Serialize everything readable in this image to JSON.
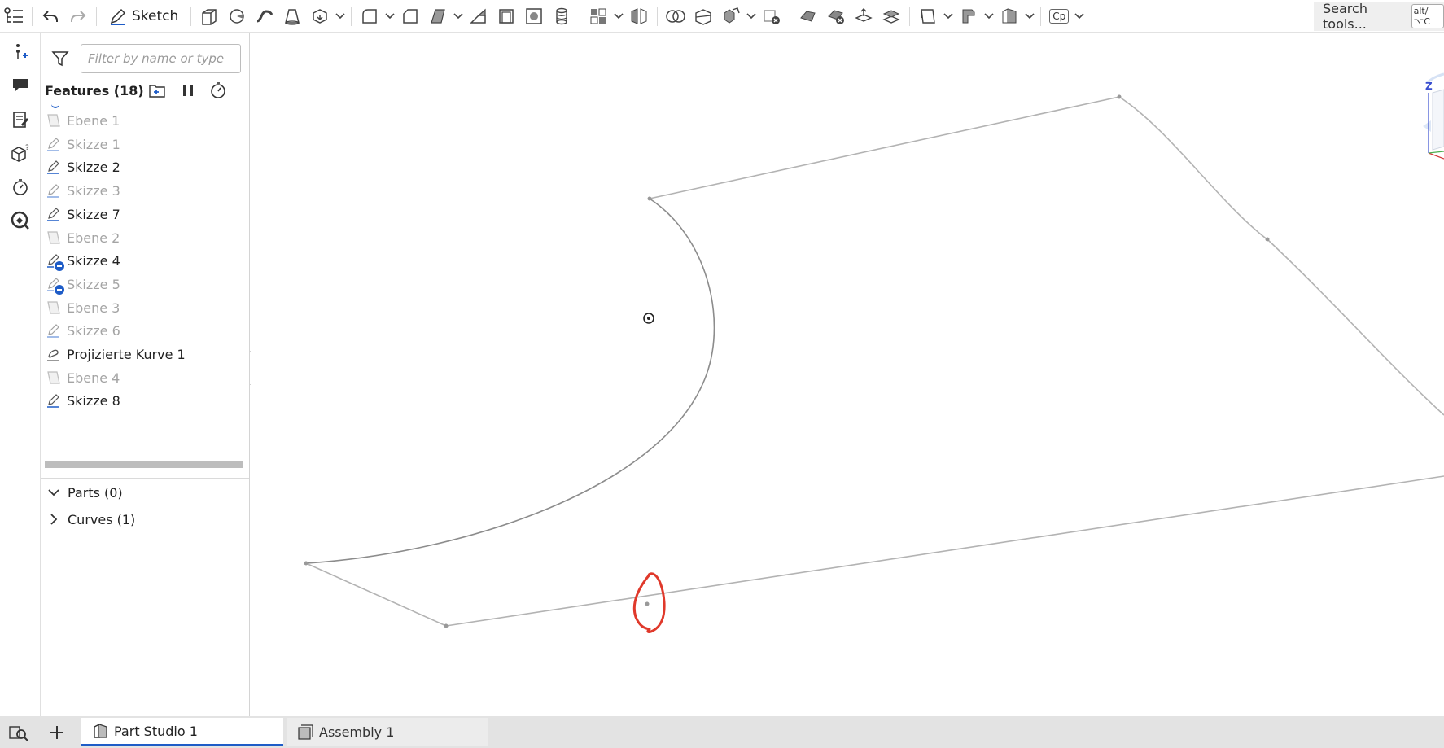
{
  "toolbar": {
    "sketch_label": "Sketch",
    "search_placeholder": "Search tools...",
    "search_shortcut": "alt/⌥C",
    "cp_label": "Cp"
  },
  "panel": {
    "filter_placeholder": "Filter by name or type",
    "features_title": "Features (18)",
    "features": [
      {
        "label": "Ebene 1",
        "icon": "plane-icon",
        "dim": true
      },
      {
        "label": "Skizze 1",
        "icon": "sketch-icon",
        "dim": true
      },
      {
        "label": "Skizze 2",
        "icon": "sketch-icon",
        "dim": false
      },
      {
        "label": "Skizze 3",
        "icon": "sketch-icon",
        "dim": true
      },
      {
        "label": "Skizze 7",
        "icon": "sketch-icon",
        "dim": false
      },
      {
        "label": "Ebene 2",
        "icon": "plane-icon",
        "dim": true
      },
      {
        "label": "Skizze 4",
        "icon": "sketch-icon",
        "dim": false,
        "suppressed_badge": true
      },
      {
        "label": "Skizze 5",
        "icon": "sketch-icon",
        "dim": true,
        "suppressed_badge": true
      },
      {
        "label": "Ebene 3",
        "icon": "plane-icon",
        "dim": true
      },
      {
        "label": "Skizze 6",
        "icon": "sketch-icon",
        "dim": true
      },
      {
        "label": "Projizierte Kurve 1",
        "icon": "projected-curve-icon",
        "dim": false
      },
      {
        "label": "Ebene 4",
        "icon": "plane-icon",
        "dim": true
      },
      {
        "label": "Skizze 8",
        "icon": "sketch-icon",
        "dim": false
      }
    ],
    "parts_label": "Parts (0)",
    "curves_label": "Curves (1)"
  },
  "viewcube": {
    "axis_label": "Z"
  },
  "tabs": {
    "part_studio": "Part Studio 1",
    "assembly": "Assembly 1"
  },
  "colors": {
    "accent": "#1e5cc7",
    "geometry_line": "#b3b3b3",
    "annotation_red": "#e0392b"
  }
}
